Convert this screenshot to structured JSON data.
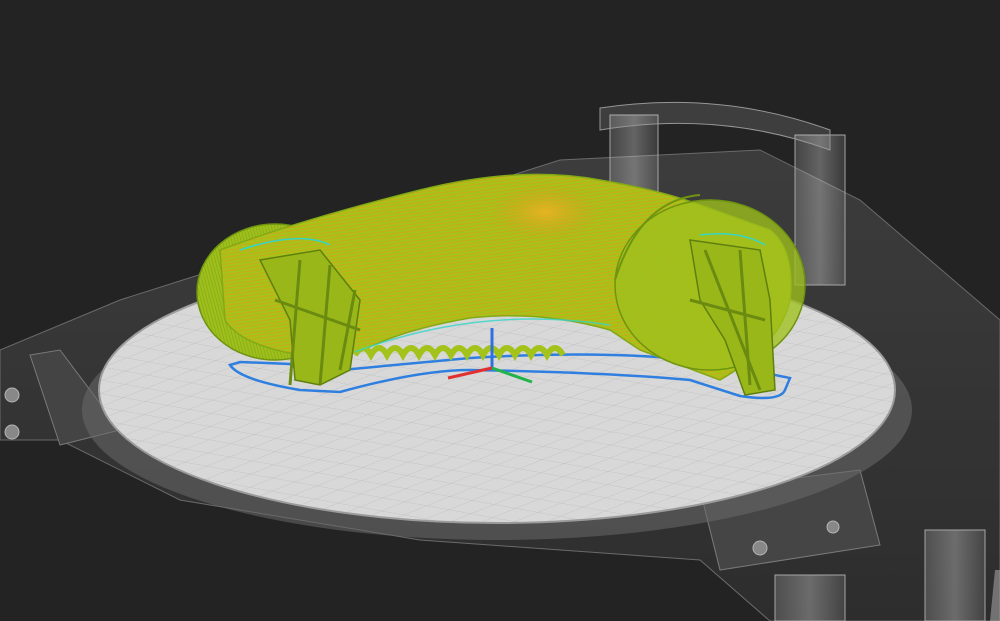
{
  "viewport": {
    "background": "#232323",
    "bed_surface": "#d9d9d9",
    "bed_grid": "#bdbdbd",
    "printer_frame": "#8a8a8a",
    "model_green": "#9cc21a",
    "model_orange": "#e0a21f",
    "skirt_blue": "#2f7fe0",
    "infill_cyan": "#33d6c8"
  },
  "axes": {
    "x_axis_color": "#e03030",
    "y_axis_color": "#22b34a",
    "z_axis_color": "#2f6fe0"
  }
}
